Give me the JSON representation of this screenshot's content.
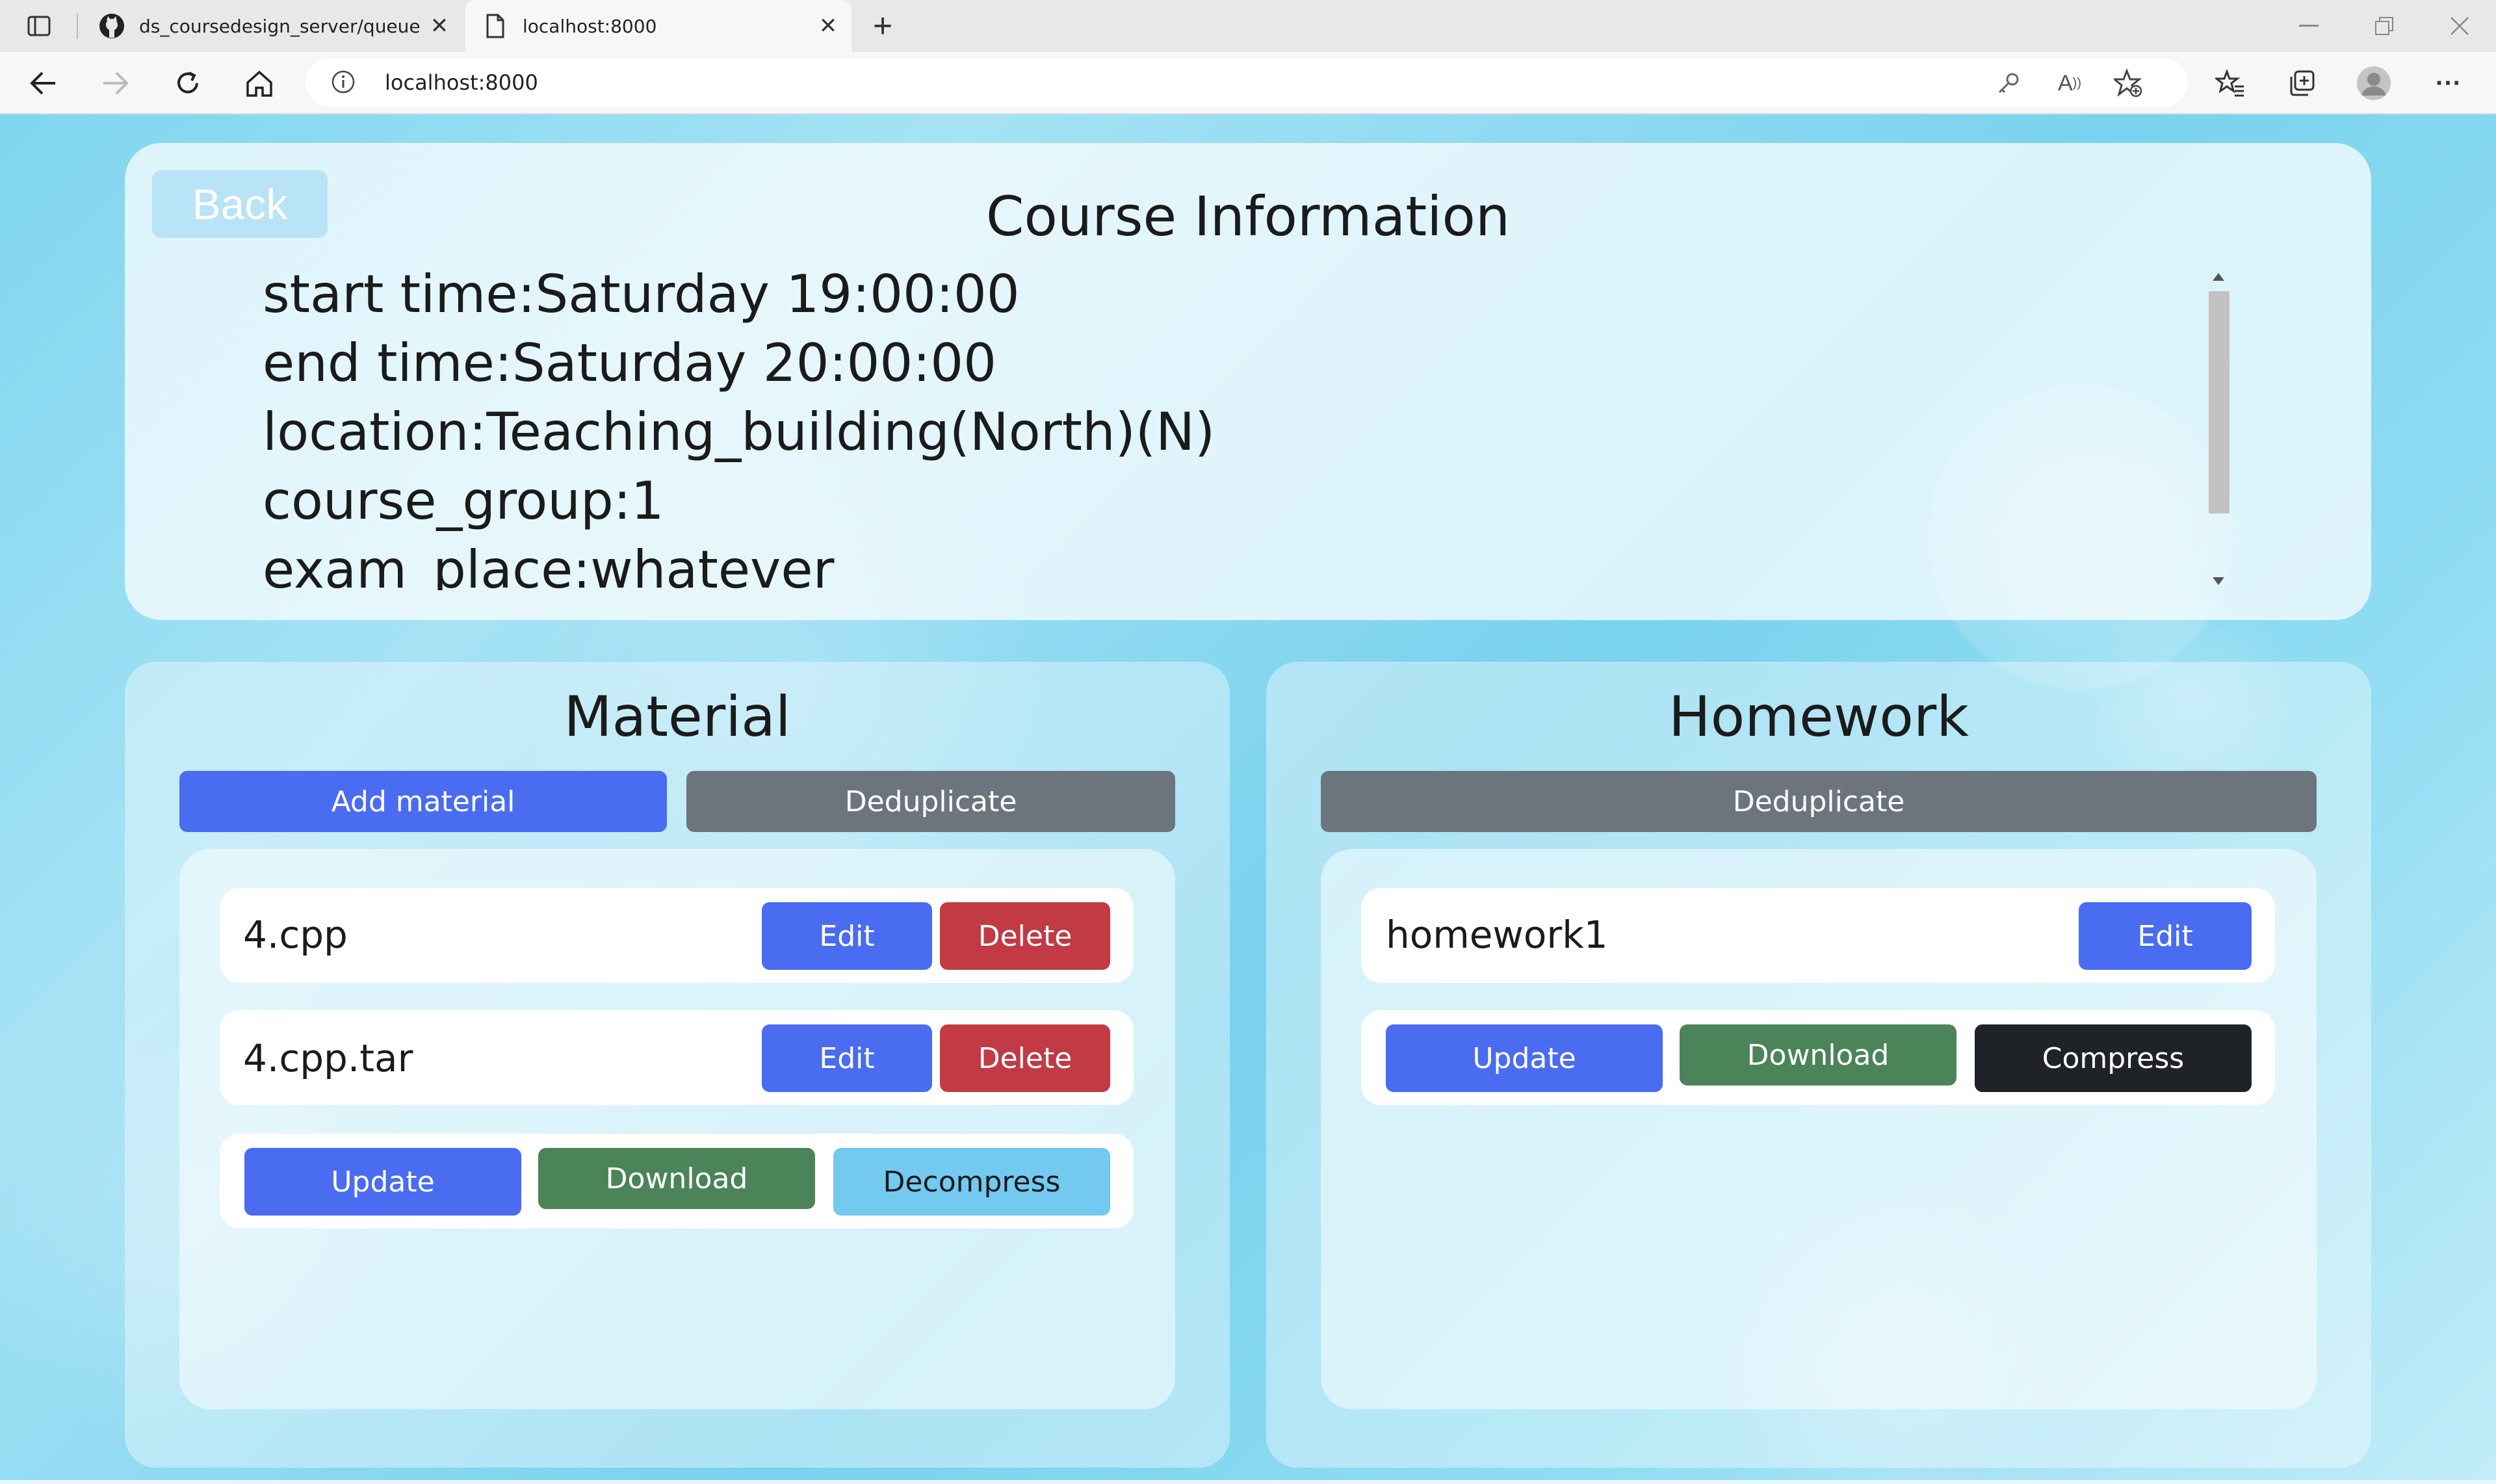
{
  "browser": {
    "tabs": [
      {
        "title": "ds_coursedesign_server/queue.p",
        "icon": "github-icon",
        "active": false
      },
      {
        "title": "localhost:8000",
        "icon": "page-icon",
        "active": true
      }
    ],
    "new_tab_label": "+",
    "url": "localhost:8000"
  },
  "page": {
    "back_label": "Back",
    "course_info": {
      "title": "Course Information",
      "lines": [
        "start time:Saturday 19:00:00",
        "end time:Saturday 20:00:00",
        "location:Teaching_building(North)(N)",
        "course_group:1",
        "exam_place:whatever"
      ]
    },
    "material": {
      "title": "Material",
      "add_label": "Add material",
      "dedup_label": "Deduplicate",
      "files": [
        {
          "name": "4.cpp",
          "edit_label": "Edit",
          "delete_label": "Delete"
        },
        {
          "name": "4.cpp.tar",
          "edit_label": "Edit",
          "delete_label": "Delete"
        }
      ],
      "actions": {
        "update": "Update",
        "download": "Download",
        "decompress": "Decompress"
      }
    },
    "homework": {
      "title": "Homework",
      "dedup_label": "Deduplicate",
      "items": [
        {
          "name": "homework1",
          "edit_label": "Edit"
        }
      ],
      "actions": {
        "update": "Update",
        "download": "Download",
        "compress": "Compress"
      }
    }
  },
  "colors": {
    "primary": "#4a6cf0",
    "secondary": "#6c757d",
    "danger": "#c13a44",
    "success": "#4a8458",
    "dark": "#1f2327",
    "info": "#73c9ef",
    "back_button": "#b9e3f6"
  }
}
